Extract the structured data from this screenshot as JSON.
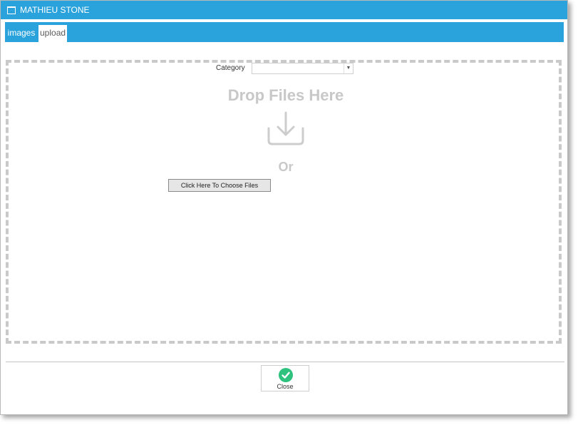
{
  "window": {
    "title": "MATHIEU STONE"
  },
  "tabs": [
    {
      "label": "images",
      "active": false
    },
    {
      "label": "upload",
      "active": true
    }
  ],
  "upload": {
    "category_label": "Category",
    "category_value": "",
    "drop_text": "Drop Files Here",
    "or_text": "Or",
    "choose_button_label": "Click Here To Choose Files"
  },
  "footer": {
    "close_label": "Close"
  },
  "colors": {
    "accent": "#2aa3dc",
    "muted_text": "#c8c8c8",
    "success": "#2ec27e"
  }
}
